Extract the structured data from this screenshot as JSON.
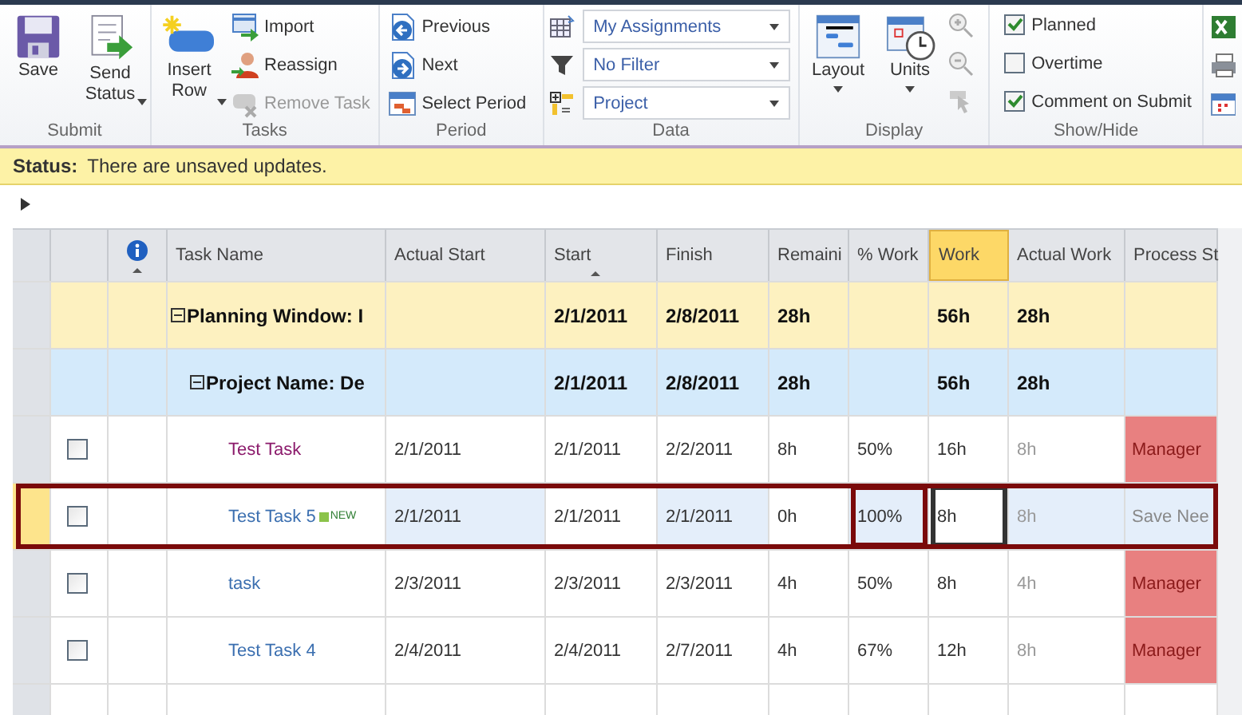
{
  "ribbon": {
    "groups": [
      {
        "kind": "submit",
        "label": "Submit",
        "buttons": [
          {
            "label": "Save"
          },
          {
            "label": "Send",
            "label2": "Status",
            "dropdown": true
          }
        ]
      },
      {
        "kind": "tasks",
        "label": "Tasks",
        "buttons": [
          {
            "label": "Insert",
            "label2": "Row",
            "dropdown": true
          }
        ],
        "small": [
          {
            "label": "Import",
            "disabled": false
          },
          {
            "label": "Reassign",
            "disabled": false
          },
          {
            "label": "Remove Task",
            "disabled": true
          }
        ]
      },
      {
        "kind": "period",
        "label": "Period",
        "small": [
          {
            "label": "Previous",
            "disabled": false
          },
          {
            "label": "Next",
            "disabled": false
          },
          {
            "label": "Select Period",
            "disabled": false
          }
        ]
      },
      {
        "kind": "data",
        "label": "Data",
        "dropdowns": [
          {
            "value": "My Assignments"
          },
          {
            "value": "No Filter"
          },
          {
            "value": "Project"
          }
        ]
      },
      {
        "kind": "display",
        "label": "Display",
        "buttons": [
          {
            "label": "Layout",
            "dropdown": true
          },
          {
            "label": "Units",
            "dropdown": true
          }
        ]
      },
      {
        "kind": "showhide",
        "label": "Show/Hide",
        "checks": [
          {
            "label": "Planned",
            "checked": true
          },
          {
            "label": "Overtime",
            "checked": false
          },
          {
            "label": "Comment on Submit",
            "checked": true
          }
        ]
      }
    ]
  },
  "status": {
    "label": "Status:",
    "text": "There are unsaved updates."
  },
  "grid": {
    "columns": [
      {
        "label": "Task Name",
        "selected": false,
        "sorted": false
      },
      {
        "label": "Actual Start",
        "selected": false,
        "sorted": false
      },
      {
        "label": "Start",
        "selected": false,
        "sorted": true
      },
      {
        "label": "Finish",
        "selected": false,
        "sorted": false
      },
      {
        "label": "Remaini",
        "selected": false,
        "sorted": false
      },
      {
        "label": "% Work",
        "selected": false,
        "sorted": false
      },
      {
        "label": "Work",
        "selected": true,
        "sorted": false
      },
      {
        "label": "Actual Work",
        "selected": false,
        "sorted": false
      },
      {
        "label": "Process St",
        "selected": false,
        "sorted": false
      }
    ],
    "rows": [
      {
        "kind": "group",
        "name": "Planning Window: I",
        "selected": false,
        "cells": {
          "start": "2/1/2011",
          "finish": "2/8/2011",
          "remaining": "28h",
          "work": "56h",
          "actual_work": "28h"
        }
      },
      {
        "kind": "project",
        "name": "Project Name: De",
        "selected": false,
        "cells": {
          "start": "2/1/2011",
          "finish": "2/8/2011",
          "remaining": "28h",
          "work": "56h",
          "actual_work": "28h"
        }
      },
      {
        "kind": "task",
        "name": "Test Task",
        "color": "#8b1a6b",
        "checked": false,
        "selected": false,
        "cells": {
          "actual_start": "2/1/2011",
          "start": "2/1/2011",
          "finish": "2/2/2011",
          "remaining": "8h",
          "pct_work": "50%",
          "work": "16h",
          "actual_work": "8h"
        },
        "process": {
          "text": "Manager",
          "color": "#e88080"
        }
      },
      {
        "kind": "task",
        "name": "Test Task 5",
        "badge": "NEW",
        "color": "#3b6fb0",
        "checked": false,
        "selected": true,
        "cells": {
          "actual_start": "2/1/2011",
          "start": "2/1/2011",
          "finish": "2/1/2011",
          "remaining": "0h",
          "pct_work": "100%",
          "work": "8h",
          "actual_work": "8h"
        },
        "process": {
          "text": "Save Nee",
          "color": "#e4eefa"
        }
      },
      {
        "kind": "task",
        "name": "task",
        "color": "#3b6fb0",
        "checked": false,
        "selected": false,
        "cells": {
          "actual_start": "2/3/2011",
          "start": "2/3/2011",
          "finish": "2/3/2011",
          "remaining": "4h",
          "pct_work": "50%",
          "work": "8h",
          "actual_work": "4h"
        },
        "process": {
          "text": "Manager",
          "color": "#e88080"
        }
      },
      {
        "kind": "task",
        "name": "Test Task 4",
        "color": "#3b6fb0",
        "checked": false,
        "selected": false,
        "cells": {
          "actual_start": "2/4/2011",
          "start": "2/4/2011",
          "finish": "2/7/2011",
          "remaining": "4h",
          "pct_work": "67%",
          "work": "12h",
          "actual_work": "8h"
        },
        "process": {
          "text": "Manager",
          "color": "#e88080"
        }
      }
    ]
  }
}
